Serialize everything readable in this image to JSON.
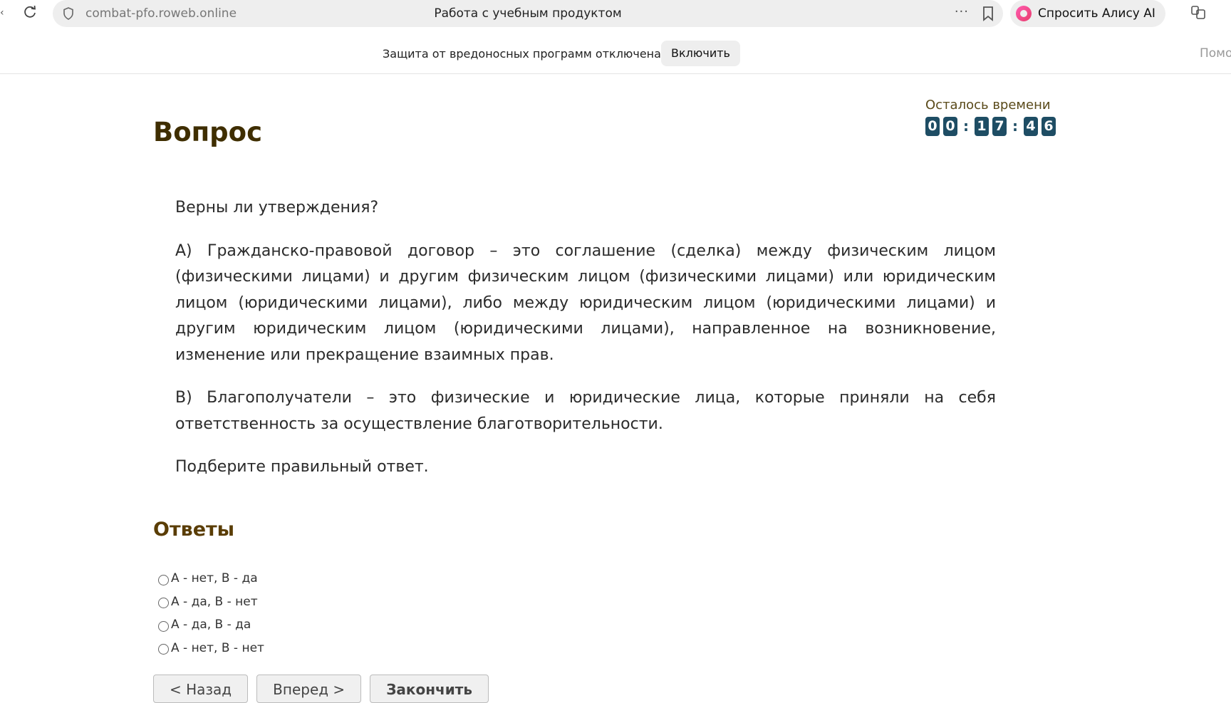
{
  "browser": {
    "url": "combat-pfo.roweb.online",
    "tab_title": "Работа с учебным продуктом",
    "alice_label": "Спросить Алису AI",
    "menu_dots": "···"
  },
  "infobar": {
    "message": "Защита от вредоносных программ отключена",
    "enable_label": "Включить",
    "help_label": "Помощь"
  },
  "page": {
    "heading": "Вопрос",
    "timer": {
      "label": "Осталось времени",
      "digits": [
        "0",
        "0",
        "1",
        "7",
        "4",
        "6"
      ],
      "separator": ":"
    },
    "question": {
      "prompt": "Верны ли утверждения?",
      "statement_a": "А) Гражданско-правовой договор – это соглашение (сделка) между физическим лицом (физическими лицами) и другим физическим лицом (физическими лицами) или юридическим лицом (юридическими лицами), либо между юридическим лицом (юридическими лицами) и другим юридическим лицом (юридическими лицами), направленное на возникновение, изменение или прекращение взаимных прав.",
      "statement_b": "В) Благополучатели – это физические и юридические лица, которые приняли на себя ответственность за осуществление благотворительности.",
      "instruction": "Подберите правильный ответ."
    },
    "answers_title": "Ответы",
    "answers": [
      "А - нет, В - да",
      "А - да, В - нет",
      "А - да, В - да",
      "А - нет, В - нет"
    ],
    "nav": {
      "back": "< Назад",
      "forward": "Вперед >",
      "finish": "Закончить"
    }
  }
}
